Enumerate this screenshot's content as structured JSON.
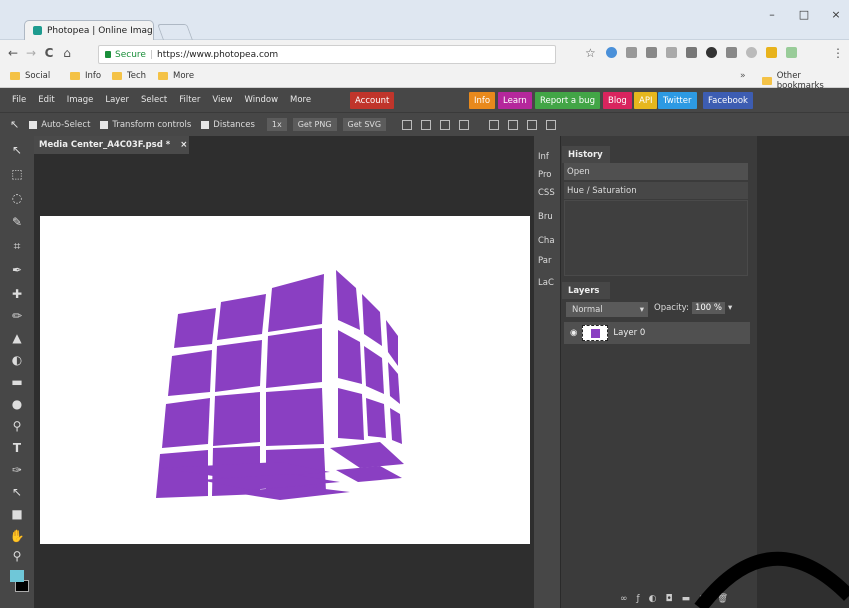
{
  "browser": {
    "tab_title": "Photopea | Online Image",
    "tab_close": "×",
    "window_controls": [
      "–",
      "□",
      "×"
    ],
    "nav": {
      "back": "←",
      "forward": "→",
      "reload": "C",
      "home": "⌂"
    },
    "address": {
      "secure_label": "Secure",
      "url": "https://www.photopea.com"
    },
    "star": "☆",
    "menu": "⋮",
    "bookmarks": [
      "Social",
      "Info",
      "Tech",
      "More"
    ],
    "bookmarks_overflow": "»",
    "other_bookmarks": "Other bookmarks"
  },
  "app": {
    "menus": [
      "File",
      "Edit",
      "Image",
      "Layer",
      "Select",
      "Filter",
      "View",
      "Window",
      "More"
    ],
    "account_label": "Account",
    "top_buttons": [
      {
        "label": "Info",
        "color": "#e8891c"
      },
      {
        "label": "Learn",
        "color": "#b5279c"
      },
      {
        "label": "Report a bug",
        "color": "#42a546"
      },
      {
        "label": "Blog",
        "color": "#d9245e"
      },
      {
        "label": "API",
        "color": "#e6b71e"
      },
      {
        "label": "Twitter",
        "color": "#2d9ae3"
      },
      {
        "label": "Facebook",
        "color": "#3d5db2"
      }
    ],
    "account_color": "#c0352b",
    "options": {
      "auto_select": "Auto-Select",
      "transform_controls": "Transform controls",
      "distances": "Distances",
      "zoom": "1x",
      "get_png": "Get PNG",
      "get_svg": "Get SVG"
    },
    "document_tab": "Media Center_A4C03F.psd *",
    "document_close": "×",
    "side_tabs": [
      "Inf",
      "Pro",
      "CSS",
      "Bru",
      "Cha",
      "Par",
      "LaC"
    ],
    "history": {
      "title": "History",
      "items": [
        "Open",
        "Hue / Saturation"
      ]
    },
    "layers": {
      "title": "Layers",
      "blend_mode": "Normal",
      "opacity_label": "Opacity:",
      "opacity_value": "100 %",
      "layer_name": "Layer 0"
    },
    "tools": [
      "move-tool",
      "marquee-tool",
      "lasso-tool",
      "quick-select-tool",
      "crop-tool",
      "eyedropper-tool",
      "healing-tool",
      "brush-tool",
      "stamp-tool",
      "eraser-tool",
      "gradient-tool",
      "blur-tool",
      "dodge-tool",
      "type-tool",
      "pen-tool",
      "path-select-tool",
      "shape-tool",
      "hand-tool",
      "zoom-tool"
    ],
    "foreground_color": "#6fc7d8",
    "background_color": "#000000",
    "artwork_color": "#8a3fc2"
  }
}
